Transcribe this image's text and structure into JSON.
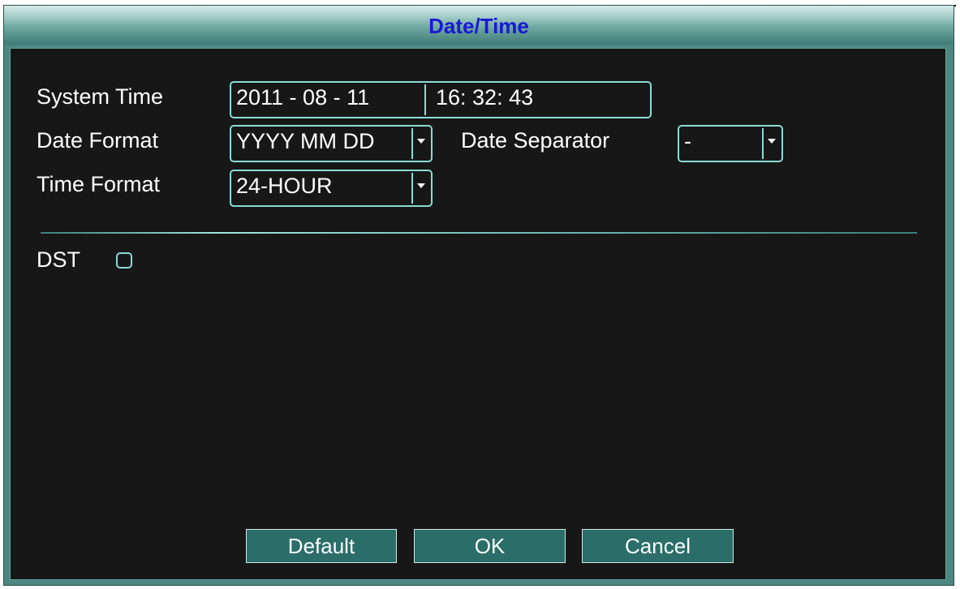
{
  "window": {
    "title": "Date/Time"
  },
  "form": {
    "system_time": {
      "label": "System Time",
      "date": "2011 - 08 - 11",
      "time": "16: 32: 43"
    },
    "date_format": {
      "label": "Date Format",
      "value": "YYYY MM DD"
    },
    "date_separator": {
      "label": "Date Separator",
      "value": "-"
    },
    "time_format": {
      "label": "Time Format",
      "value": "24-HOUR"
    },
    "dst": {
      "label": "DST",
      "checked": false
    }
  },
  "buttons": {
    "default_label": "Default",
    "ok_label": "OK",
    "cancel_label": "Cancel"
  },
  "colors": {
    "title_text": "#1919d6",
    "panel_background": "#171717",
    "field_border": "#8bdbd6",
    "button_background": "#2b6e69"
  },
  "icons": {
    "dropdown": "chevron-down-icon",
    "checkbox": "checkbox-icon"
  }
}
